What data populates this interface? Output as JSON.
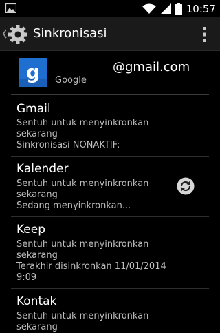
{
  "status_bar": {
    "time": "10:57",
    "icons": [
      "image-notification-icon",
      "wifi-icon",
      "cell-signal-icon",
      "battery-icon"
    ]
  },
  "action_bar": {
    "title": "Sinkronisasi",
    "icons": [
      "up-caret-icon",
      "settings-gear-icon",
      "overflow-menu-icon"
    ]
  },
  "account": {
    "email": "@gmail.com",
    "type": "Google",
    "logo_letter": "g"
  },
  "sync_items": [
    {
      "title": "Gmail",
      "subtitle": "Sentuh untuk menyinkronkan sekarang",
      "status": "Sinkronisasi NONAKTIF:"
    },
    {
      "title": "Kalender",
      "subtitle": "Sentuh untuk menyinkronkan sekarang",
      "status": "Sedang menyinkronkan..."
    },
    {
      "title": "Keep",
      "subtitle": "Sentuh untuk menyinkronkan sekarang",
      "status": "Terakhir disinkronkan 11/01/2014 9:09"
    },
    {
      "title": "Kontak",
      "subtitle": "Sentuh untuk menyinkronkan sekarang",
      "status": ""
    }
  ],
  "colors": {
    "background": "#000000",
    "action_bar": "#1a1a1a",
    "google_blue": "#1f6fd1",
    "secondary_text": "#bdbdbd"
  }
}
